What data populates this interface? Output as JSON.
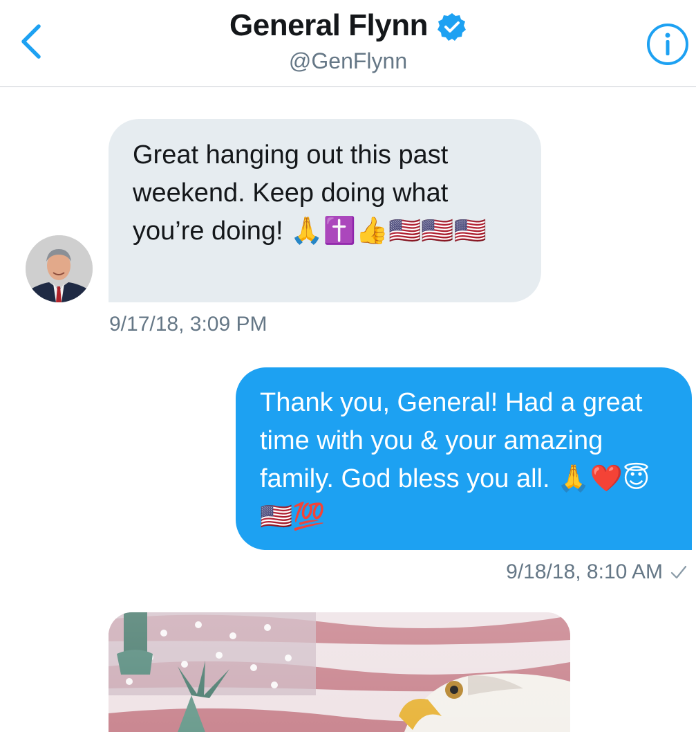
{
  "header": {
    "title": "General Flynn",
    "handle": "@GenFlynn",
    "back_icon": "chevron-left-icon",
    "info_icon": "info-icon",
    "verified_icon": "verified-badge-icon",
    "accent_color": "#1da1f2"
  },
  "messages": [
    {
      "direction": "received",
      "text": "Great hanging out this past weekend. Keep doing what you’re doing! 🙏✝️👍🇺🇸🇺🇸🇺🇸",
      "timestamp": "9/17/18, 3:09 PM",
      "bubble_color": "#e6ecf0"
    },
    {
      "direction": "sent",
      "text": "Thank you, General! Had a great time with you & your amazing family. God bless you all. 🙏❤️😇🇺🇸💯",
      "timestamp": "9/18/18, 8:10 AM",
      "status_icon": "checkmark-icon",
      "bubble_color": "#1da1f2"
    },
    {
      "direction": "received",
      "type": "image",
      "image_description_icon": "photo-icon"
    }
  ]
}
